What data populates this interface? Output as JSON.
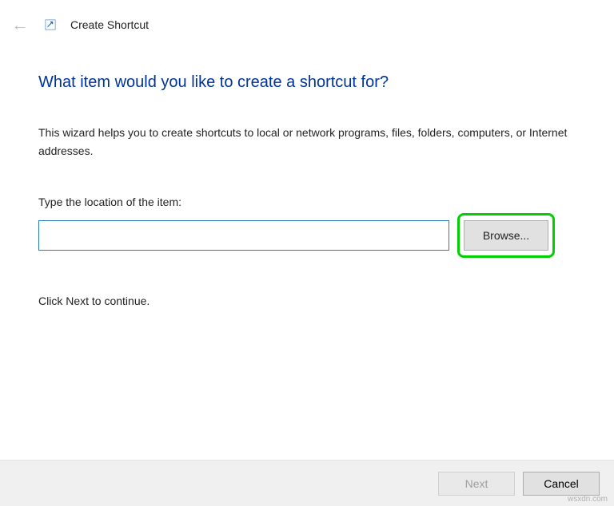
{
  "header": {
    "window_title": "Create Shortcut"
  },
  "main": {
    "heading": "What item would you like to create a shortcut for?",
    "description": "This wizard helps you to create shortcuts to local or network programs, files, folders, computers, or Internet addresses.",
    "field_label": "Type the location of the item:",
    "location_value": "",
    "browse_label": "Browse...",
    "continue_text": "Click Next to continue."
  },
  "footer": {
    "next_label": "Next",
    "cancel_label": "Cancel",
    "next_enabled": false
  },
  "watermark": "wsxdn.com"
}
